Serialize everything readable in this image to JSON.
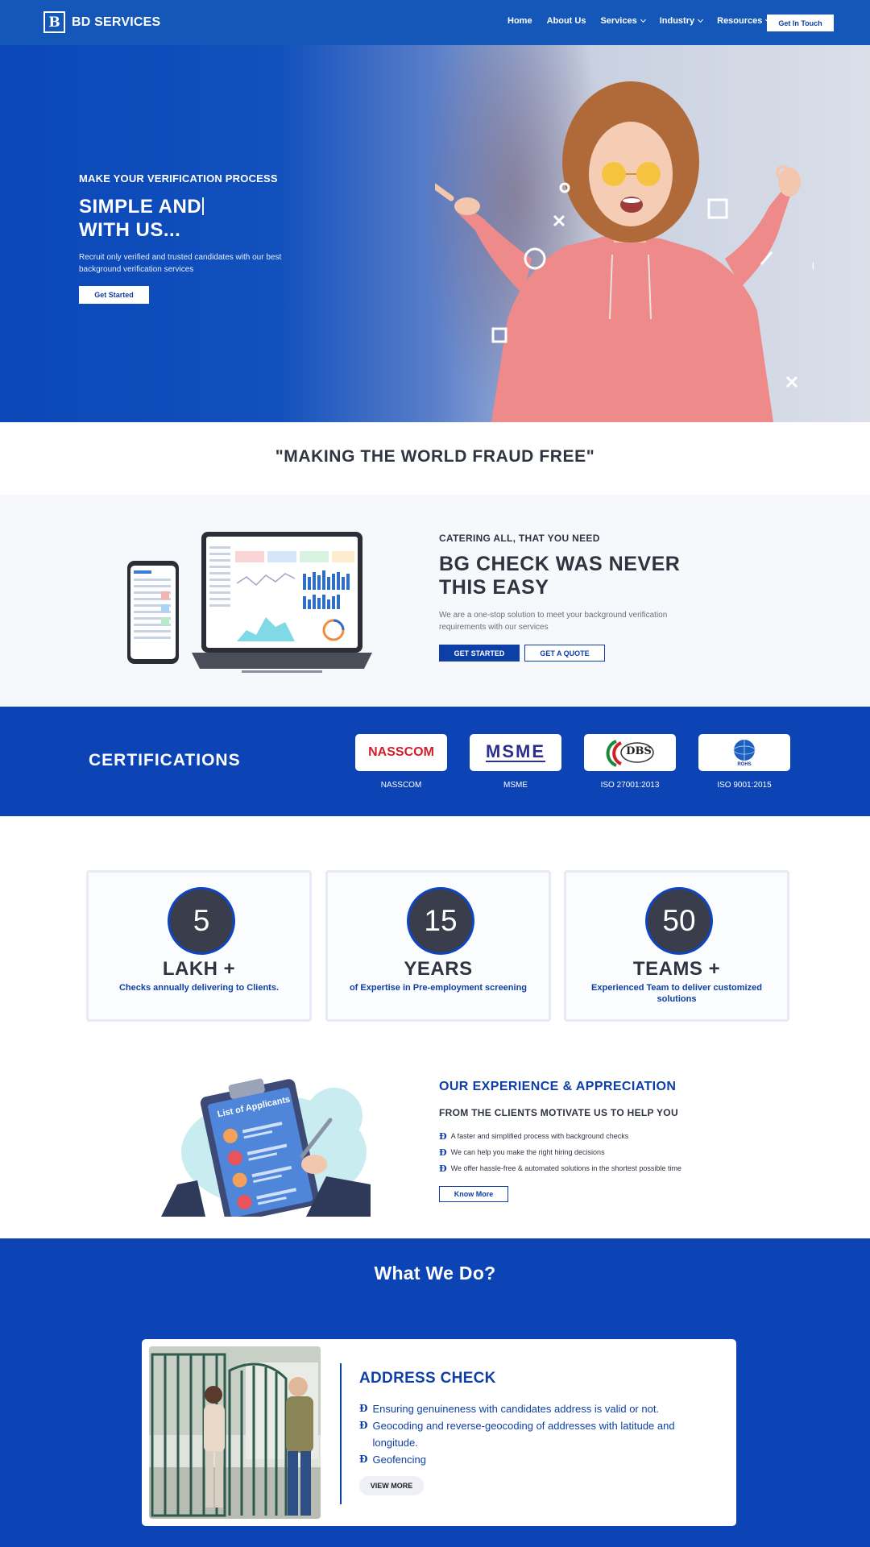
{
  "brand": {
    "logo_letter": "B",
    "name": "BD SERVICES"
  },
  "nav": {
    "items": [
      {
        "label": "Home",
        "has_dropdown": false
      },
      {
        "label": "About Us",
        "has_dropdown": false
      },
      {
        "label": "Services",
        "has_dropdown": true
      },
      {
        "label": "Industry",
        "has_dropdown": true
      },
      {
        "label": "Resources",
        "has_dropdown": true
      }
    ],
    "cta": "Get In Touch"
  },
  "hero": {
    "eyebrow": "MAKE YOUR VERIFICATION PROCESS",
    "title_line1": "SIMPLE AND",
    "title_line2": "WITH US...",
    "description": "Recruit only verified and trusted candidates with our best background verification services",
    "button": "Get Started"
  },
  "slogan": "\"MAKING THE WORLD FRAUD FREE\"",
  "bgcheck": {
    "eyebrow": "CATERING ALL, THAT YOU NEED",
    "title": "BG CHECK WAS NEVER THIS EASY",
    "description": "We are a one-stop solution to meet your background verification requirements with our services",
    "button_primary": "GET STARTED",
    "button_secondary": "GET A QUOTE"
  },
  "certifications": {
    "title": "CERTIFICATIONS",
    "items": [
      {
        "label": "NASSCOM",
        "logo_text": "NASSCOM"
      },
      {
        "label": "MSME",
        "logo_text": "MSME"
      },
      {
        "label": "ISO 27001:2013",
        "logo_text": "DBS"
      },
      {
        "label": "ISO 9001:2015",
        "logo_text": "ROHS"
      }
    ]
  },
  "stats": [
    {
      "number": "5",
      "unit": "LAKH +",
      "description": "Checks annually delivering to Clients."
    },
    {
      "number": "15",
      "unit": "YEARS",
      "description": "of Expertise in Pre-employment screening"
    },
    {
      "number": "50",
      "unit": "TEAMS +",
      "description": "Experienced Team to deliver customized solutions"
    }
  ],
  "experience": {
    "title": "OUR EXPERIENCE & APPRECIATION",
    "subtitle": "FROM THE CLIENTS MOTIVATE US TO HELP YOU",
    "bullets": [
      "A faster and simplified process with background checks",
      "We can help you make the right hiring decisions",
      "We offer hassle-free & automated solutions in the shortest possible time"
    ],
    "button": "Know More",
    "illustration_title": "List of Applicants"
  },
  "what_we_do": {
    "title": "What We Do?",
    "service": {
      "title": "ADDRESS CHECK",
      "bullets": [
        "Ensuring genuineness with candidates address is valid or not.",
        "Geocoding and reverse-geocoding of addresses with latitude and longitude.",
        "Geofencing"
      ],
      "button": "VIEW MORE"
    }
  },
  "colors": {
    "primary_blue": "#0c44b5",
    "nav_blue": "#1457b8",
    "dark_text": "#2f3441",
    "stat_circle": "#3a3d4c",
    "hoodie_pink": "#ef8a8a"
  },
  "icons": [
    "logo-icon",
    "chevron-down-icon",
    "bd-bullet-icon"
  ]
}
